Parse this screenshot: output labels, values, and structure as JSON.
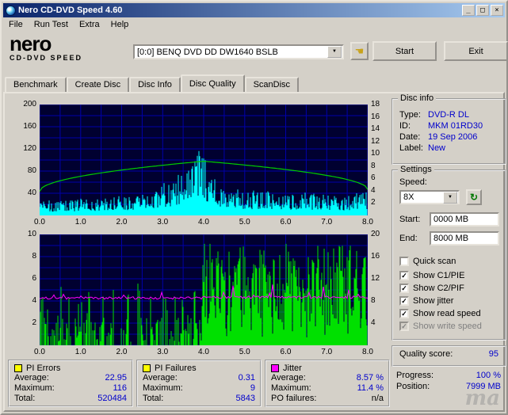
{
  "window": {
    "title": "Nero CD-DVD Speed 4.60",
    "minimize": "_",
    "maximize": "□",
    "close": "×"
  },
  "menu": [
    "File",
    "Run Test",
    "Extra",
    "Help"
  ],
  "toolbar": {
    "logo_main": "nero",
    "logo_sub": "CD-DVD SPEED",
    "drive": "[0:0]   BENQ DVD DD DW1640 BSLB",
    "combo_arrow": "▼",
    "hand_glyph": "☚",
    "start": "Start",
    "exit": "Exit"
  },
  "tabs": {
    "items": [
      "Benchmark",
      "Create Disc",
      "Disc Info",
      "Disc Quality",
      "ScanDisc"
    ],
    "active": 3
  },
  "disc_info": {
    "title": "Disc info",
    "rows": [
      {
        "label": "Type:",
        "value": "DVD-R DL"
      },
      {
        "label": "ID:",
        "value": "MKM 01RD30"
      },
      {
        "label": "Date:",
        "value": "19 Sep 2006"
      },
      {
        "label": "Label:",
        "value": "New"
      }
    ]
  },
  "settings": {
    "title": "Settings",
    "speed_label": "Speed:",
    "speed_value": "8X",
    "speed_arrow": "▼",
    "refresh_glyph": "↻",
    "start_label": "Start:",
    "start_value": "0000 MB",
    "end_label": "End:",
    "end_value": "8000 MB",
    "checkboxes": [
      {
        "label": "Quick scan",
        "checked": false,
        "disabled": false
      },
      {
        "label": "Show C1/PIE",
        "checked": true,
        "disabled": false
      },
      {
        "label": "Show C2/PIF",
        "checked": true,
        "disabled": false
      },
      {
        "label": "Show jitter",
        "checked": true,
        "disabled": false
      },
      {
        "label": "Show read speed",
        "checked": true,
        "disabled": false
      },
      {
        "label": "Show write speed",
        "checked": true,
        "disabled": true
      }
    ]
  },
  "quality": {
    "label": "Quality score:",
    "value": "95"
  },
  "status": {
    "rows": [
      {
        "label": "Progress:",
        "value": "100 %"
      },
      {
        "label": "Position:",
        "value": "7999 MB"
      }
    ]
  },
  "watermark": "ma",
  "stat_boxes": [
    {
      "swatch": "#ffff00",
      "title": "PI Errors",
      "rows": [
        {
          "label": "Average:",
          "value": "22.95"
        },
        {
          "label": "Maximum:",
          "value": "116"
        },
        {
          "label": "Total:",
          "value": "520484"
        }
      ]
    },
    {
      "swatch": "#ffff00",
      "title": "PI Failures",
      "rows": [
        {
          "label": "Average:",
          "value": "0.31"
        },
        {
          "label": "Maximum:",
          "value": "9"
        },
        {
          "label": "Total:",
          "value": "5843"
        }
      ]
    },
    {
      "swatch": "#ff00ff",
      "title": "Jitter",
      "rows": [
        {
          "label": "Average:",
          "value": "8.57 %"
        },
        {
          "label": "Maximum:",
          "value": "11.4 %"
        },
        {
          "label": "PO failures:",
          "value": "n/a"
        }
      ]
    }
  ],
  "chart_data": [
    {
      "type": "area",
      "name": "PI Errors scan (C1/PIE with read speed overlay)",
      "x_ticks": [
        "0.0",
        "1.0",
        "2.0",
        "3.0",
        "4.0",
        "5.0",
        "6.0",
        "7.0",
        "8.0"
      ],
      "left_ticks": [
        "200",
        "160",
        "120",
        "80",
        "40"
      ],
      "right_ticks": [
        "18",
        "16",
        "14",
        "12",
        "10",
        "8",
        "6",
        "4",
        "2"
      ],
      "x_max": 8,
      "y_left_max": 200,
      "y_right_max": 18,
      "pie_average": 22.95,
      "pie_maximum": 116,
      "pie_total": 520484,
      "pie_envelope": [
        [
          0,
          26
        ],
        [
          1,
          30
        ],
        [
          2,
          36
        ],
        [
          2.8,
          48
        ],
        [
          3.3,
          70
        ],
        [
          3.7,
          95
        ],
        [
          3.9,
          120
        ],
        [
          4.0,
          118
        ],
        [
          4.1,
          88
        ],
        [
          4.25,
          64
        ],
        [
          4.6,
          52
        ],
        [
          5,
          46
        ],
        [
          5.5,
          44
        ],
        [
          6,
          42
        ],
        [
          6.5,
          40
        ],
        [
          7,
          40
        ],
        [
          7.5,
          36
        ],
        [
          8,
          42
        ]
      ],
      "speed_line": {
        "start": 3.9,
        "peak": 8.8,
        "end": 4.2,
        "peak_x": 4.0
      }
    },
    {
      "type": "spikes+line",
      "name": "PI Failures (C2/PIF) and Jitter scan",
      "x_ticks": [
        "0.0",
        "1.0",
        "2.0",
        "3.0",
        "4.0",
        "5.0",
        "6.0",
        "7.0",
        "8.0"
      ],
      "left_ticks": [
        "10",
        "8",
        "6",
        "4",
        "2"
      ],
      "right_ticks": [
        "20",
        "16",
        "12",
        "8",
        "4"
      ],
      "x_max": 8,
      "y_left_max": 10,
      "y_right_max": 20,
      "pif_average": 0.31,
      "pif_maximum": 9,
      "pif_total": 5843,
      "jitter_average_pct": 8.57,
      "jitter_maximum_pct": 11.4,
      "layer_break_x": 4.0
    }
  ],
  "colors": {
    "titlebar_left": "#0a246a",
    "titlebar_right": "#a6caf0",
    "plot_bg": "#000030",
    "grid": "#0000aa",
    "pie": "#00ffff",
    "speed": "#00cc00",
    "pif": "#00e000",
    "jitter": "#ff00ff",
    "value": "#0000cc",
    "window_bg": "#d4d0c8"
  }
}
